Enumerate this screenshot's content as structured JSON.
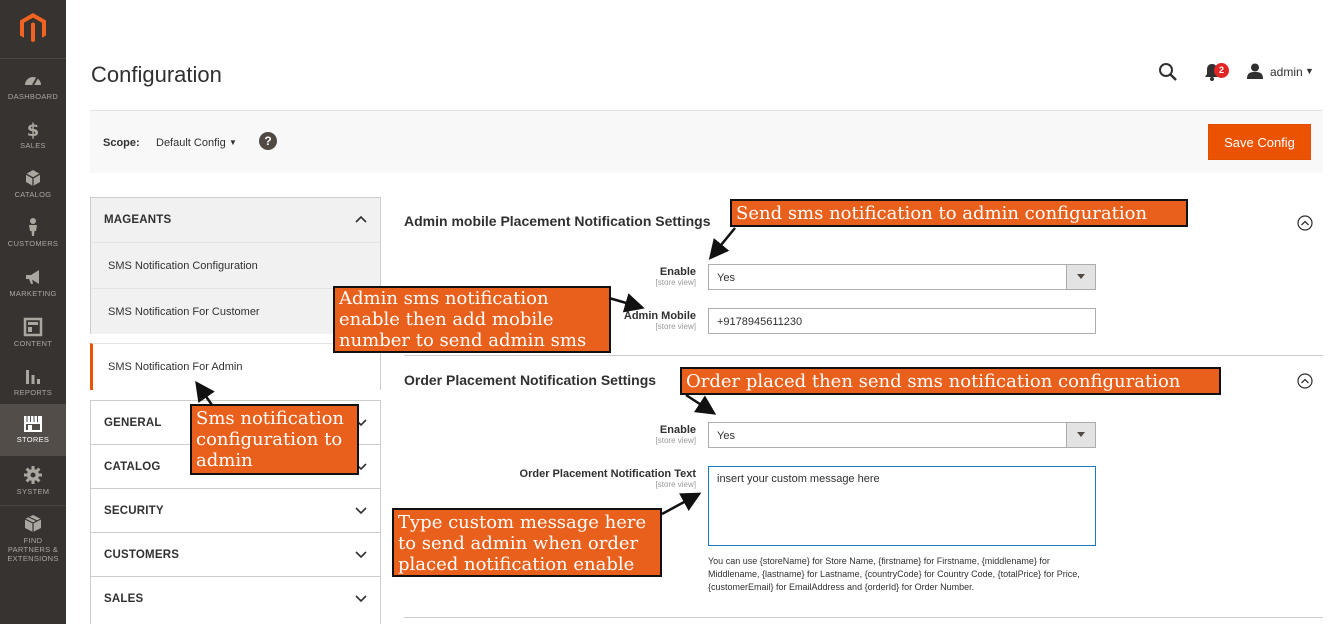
{
  "nav": {
    "items": [
      {
        "key": "dashboard",
        "label": "DASHBOARD"
      },
      {
        "key": "sales",
        "label": "SALES"
      },
      {
        "key": "catalog",
        "label": "CATALOG"
      },
      {
        "key": "customers",
        "label": "CUSTOMERS"
      },
      {
        "key": "marketing",
        "label": "MARKETING"
      },
      {
        "key": "content",
        "label": "CONTENT"
      },
      {
        "key": "reports",
        "label": "REPORTS"
      },
      {
        "key": "stores",
        "label": "STORES"
      },
      {
        "key": "system",
        "label": "SYSTEM"
      },
      {
        "key": "partners",
        "label": "FIND PARTNERS & EXTENSIONS"
      }
    ],
    "active": "stores"
  },
  "header": {
    "title": "Configuration",
    "notifications_count": "2",
    "user": "admin"
  },
  "scope": {
    "label": "Scope:",
    "value": "Default Config",
    "help": "?",
    "save_label": "Save Config"
  },
  "sidebar": {
    "mageants": "MAGEANTS",
    "subitems": [
      "SMS Notification Configuration",
      "SMS Notification For Customer",
      "SMS Notification For Admin"
    ],
    "groups": [
      "GENERAL",
      "CATALOG",
      "SECURITY",
      "CUSTOMERS",
      "SALES"
    ]
  },
  "section1": {
    "title": "Admin mobile Placement Notification Settings",
    "enable_label": "Enable",
    "enable_scope": "[store view]",
    "enable_value": "Yes",
    "mobile_label": "Admin Mobile",
    "mobile_scope": "[store view]",
    "mobile_value": "+9178945611230"
  },
  "section2": {
    "title": "Order Placement Notification Settings",
    "enable_label": "Enable",
    "enable_scope": "[store view]",
    "enable_value": "Yes",
    "text_label": "Order Placement Notification Text",
    "text_scope": "[store view]",
    "text_value": "insert your custom message here",
    "note": "You can use {storeName} for Store Name, {firstname} for Firstname, {middlename} for Middlename, {lastname} for Lastname, {countryCode} for Country Code, {totalPrice} for Price, {customerEmail} for EmailAddress and {orderId} for Order Number."
  },
  "annotations": {
    "a1": "Send sms notification to admin configuration",
    "a2": "Admin sms notification\nenable then add  mobile\nnumber to send admin sms",
    "a3": "Sms notification\nconfiguration to\nadmin",
    "a4": "Order placed then send sms notification configuration",
    "a5": "Type custom message here\nto send admin when order\nplaced notification enable"
  },
  "colors": {
    "accent": "#eb5202",
    "nav_bg": "#373330",
    "callout": "#e8601c"
  }
}
